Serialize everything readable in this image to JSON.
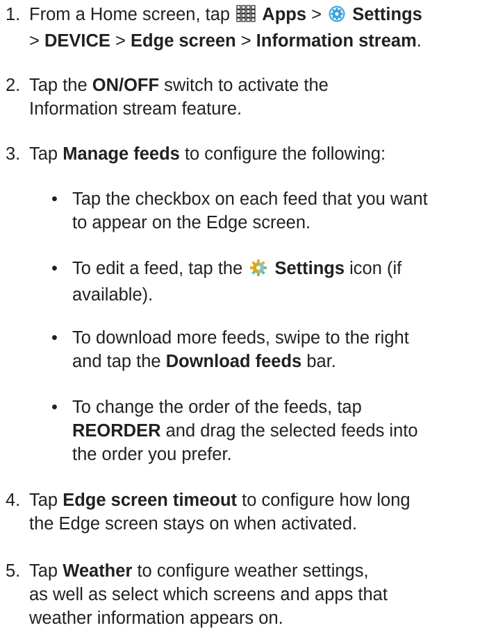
{
  "steps": [
    {
      "number": "1.",
      "parts": {
        "t1": "From a Home screen, tap",
        "apps": "Apps",
        "sep1": ">",
        "settings": "Settings",
        "sep2": ">",
        "device": "DEVICE",
        "sep3": ">",
        "edge": "Edge screen",
        "sep4": ">",
        "info": "Information stream",
        "end": "."
      }
    },
    {
      "number": "2.",
      "parts": {
        "t1": "Tap the",
        "onoff": "ON/OFF",
        "t2": "switch to activate the",
        "t3": "Information stream feature."
      }
    },
    {
      "number": "3.",
      "parts": {
        "t1": "Tap",
        "manage": "Manage feeds",
        "t2": "to configure the following:"
      }
    },
    {
      "number": "4.",
      "parts": {
        "t1": "Tap",
        "timeout": "Edge screen timeout",
        "t2": "to configure how long",
        "t3": "the Edge screen stays on when activated."
      }
    },
    {
      "number": "5.",
      "parts": {
        "t1": "Tap",
        "weather": "Weather",
        "t2": "to configure weather settings,",
        "t3": "as well as select which screens and apps that",
        "t4": "weather information appears on."
      }
    }
  ],
  "bullets": [
    {
      "dot": "•",
      "l1": "Tap the checkbox on each feed that you want",
      "l2": "to appear on the Edge screen."
    },
    {
      "dot": "•",
      "t1": "To edit a feed, tap the",
      "settings": "Settings",
      "t2": "icon (if",
      "l2": "available)."
    },
    {
      "dot": "•",
      "l1": "To download more feeds, swipe to the right",
      "t1": "and tap the",
      "download": "Download feeds",
      "t2": "bar."
    },
    {
      "dot": "•",
      "l1": "To change the order of the feeds, tap",
      "reorder": "REORDER",
      "t1": "and drag the selected feeds into",
      "l3": "the order you prefer."
    }
  ],
  "icons": {
    "apps": "apps-grid-icon",
    "settings_blue": "settings-gear-icon",
    "settings_gear": "feed-settings-gear-icon"
  },
  "colors": {
    "text": "#231f20",
    "gear_blue": "#3aa0d8",
    "gear_yellow": "#e8b21a",
    "gear_teal": "#6fb8a8"
  }
}
